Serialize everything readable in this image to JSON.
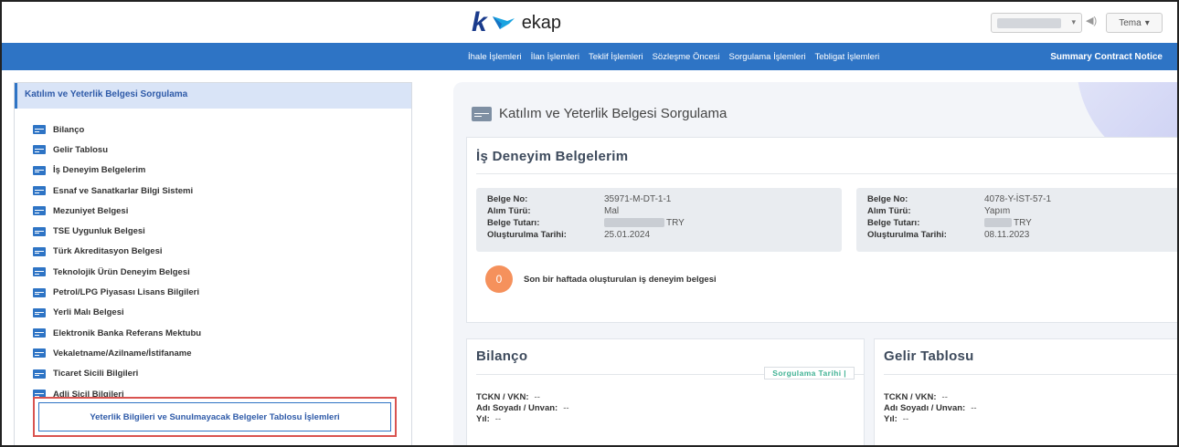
{
  "brand": {
    "name": "ekap"
  },
  "header": {
    "theme_label": "Tema",
    "caret": "▾"
  },
  "nav": {
    "items": [
      "İhale İşlemleri",
      "İlan İşlemleri",
      "Teklif İşlemleri",
      "Sözleşme Öncesi",
      "Sorgulama İşlemleri",
      "Tebligat İşlemleri"
    ],
    "right_label": "Summary Contract Notice"
  },
  "sidebar": {
    "title": "Katılım ve Yeterlik Belgesi Sorgulama",
    "items": [
      "Bilanço",
      "Gelir Tablosu",
      "İş Deneyim Belgelerim",
      "Esnaf ve Sanatkarlar Bilgi Sistemi",
      "Mezuniyet Belgesi",
      "TSE Uygunluk Belgesi",
      "Türk Akreditasyon Belgesi",
      "Teknolojik Ürün Deneyim Belgesi",
      "Petrol/LPG Piyasası Lisans Bilgileri",
      "Yerli Malı Belgesi",
      "Elektronik Banka Referans Mektubu",
      "Vekaletname/Azilname/İstifaname",
      "Ticaret Sicili Bilgileri",
      "Adli Sicil Bilgileri"
    ],
    "table_button_label": "Yeterlik Bilgileri ve Sunulmayacak Belgeler Tablosu İşlemleri"
  },
  "main": {
    "title": "Katılım ve Yeterlik Belgesi Sorgulama",
    "experience": {
      "title": "İş Deneyim Belgelerim",
      "labels": {
        "belge_no": "Belge No:",
        "alim_turu": "Alım Türü:",
        "belge_tutari": "Belge Tutarı:",
        "olusturulma": "Oluşturulma Tarihi:"
      },
      "cards": [
        {
          "belge_no": "35971-M-DT-1-1",
          "alim_turu": "Mal",
          "currency": "TRY",
          "tarih": "25.01.2024"
        },
        {
          "belge_no": "4078-Y-İST-57-1",
          "alim_turu": "Yapım",
          "currency": "TRY",
          "tarih": "08.11.2023"
        }
      ],
      "count": "0",
      "count_label": "Son bir haftada oluşturulan iş deneyim belgesi"
    },
    "bilanco": {
      "title": "Bilanço",
      "query_date_label": "Sorgulama Tarihi |",
      "lines": [
        {
          "label": "TCKN / VKN:",
          "value": "--"
        },
        {
          "label": "Adı Soyadı / Unvan:",
          "value": "--"
        },
        {
          "label": "Yıl:",
          "value": "--"
        }
      ]
    },
    "gelir": {
      "title": "Gelir Tablosu",
      "lines": [
        {
          "label": "TCKN / VKN:",
          "value": "--"
        },
        {
          "label": "Adı Soyadı / Unvan:",
          "value": "--"
        },
        {
          "label": "Yıl:",
          "value": "--"
        }
      ]
    }
  },
  "colors": {
    "primary": "#2e74c5",
    "badge": "#f5915c",
    "highlight": "#d9534f",
    "tag_text": "#41b294"
  }
}
